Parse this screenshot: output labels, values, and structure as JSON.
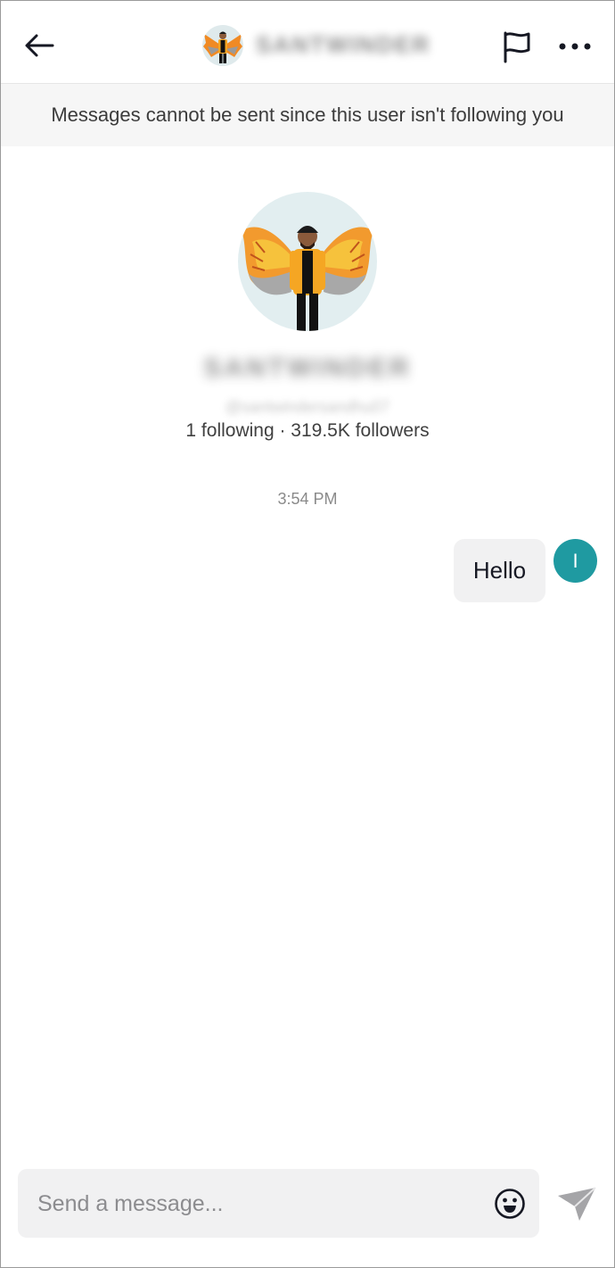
{
  "header": {
    "contact_name": "SANTWINDER",
    "icons": {
      "back": "back-arrow-icon",
      "report": "flag-icon",
      "more": "more-dots-icon"
    }
  },
  "notice": {
    "text": "Messages cannot be sent since this user isn't following you"
  },
  "profile": {
    "name": "SANTWINDER",
    "handle": "@santwindersandhu07",
    "stats": "1 following · 319.5K followers"
  },
  "conversation": {
    "timestamp": "3:54 PM",
    "messages": [
      {
        "text": "Hello",
        "sender_initial": "I",
        "avatar_color": "#1f9aa1"
      }
    ]
  },
  "composer": {
    "placeholder": "Send a message...",
    "emoji_icon": "smiley-icon",
    "send_icon": "send-icon"
  },
  "colors": {
    "accent": "#1f9aa1",
    "bubble_bg": "#f1f1f2",
    "notice_bg": "#f6f6f6"
  }
}
